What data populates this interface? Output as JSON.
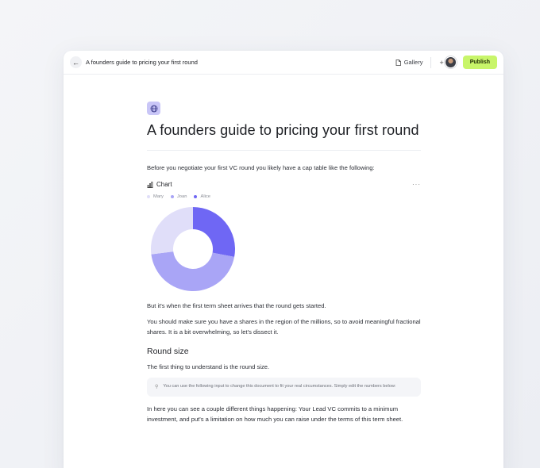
{
  "topbar": {
    "title": "A founders guide to pricing your first round",
    "gallery_label": "Gallery",
    "plus_label": "+",
    "publish_label": "Publish"
  },
  "doc": {
    "heading": "A founders guide to pricing your first round",
    "intro": "Before you negotiate your first VC round you likely have a cap table like the following:",
    "chart_label": "Chart",
    "more_label": "···",
    "after_chart": "But it's when the first term sheet arrives that the round gets started.",
    "shares_para": "You should make sure you have a shares in the region of the millions, so to avoid meaningful fractional shares. It is a bit overwhelming, so let's dissect it.",
    "section_heading": "Round size",
    "round_para": "The first thing to understand is the round size.",
    "callout": "You can use the following input to change this document to fit your real circumstances. Simply edit the numbers below:",
    "vc_para": "In here you can see a couple different things happening: Your Lead VC commits to a minimum investment, and put's a limitation on how much you can raise under the terms of this term sheet."
  },
  "colors": {
    "accent": "#c8f56a",
    "mary": "#e0def9",
    "joan": "#a9a5f6",
    "alice": "#6f67f4"
  },
  "chart_data": {
    "type": "pie",
    "categories": [
      "Mary",
      "Joan",
      "Alice"
    ],
    "values": [
      27,
      45,
      28
    ],
    "legend": "top-left"
  }
}
